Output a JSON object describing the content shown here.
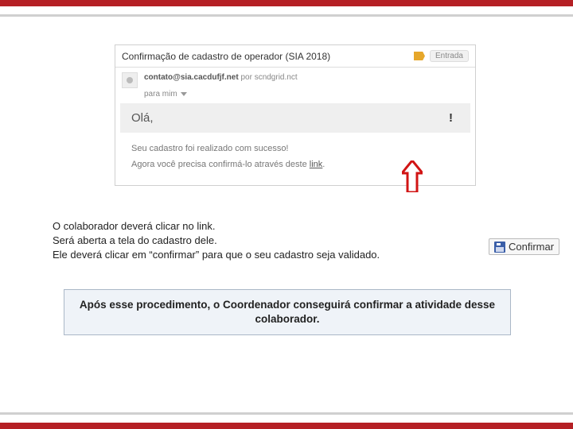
{
  "email": {
    "subject": "Confirmação de cadastro de operador (SIA  2018)",
    "inbox_label": "Entrada",
    "from_address": "contato@sia.cacdufjf.net",
    "via_word": "por",
    "via_domain": "scndgrid.nct",
    "to_line": "para mim",
    "greeting": "Olá,",
    "exclaim": "!",
    "body_line1": "Seu cadastro foi realizado com sucesso!",
    "body_line2_pre": "Agora você precisa confirmá-lo através deste ",
    "body_line2_link": "link",
    "body_line2_post": "."
  },
  "instructions": {
    "l1": "O colaborador deverá clicar no link.",
    "l2": "Será aberta a tela do cadastro dele.",
    "l3": "Ele deverá clicar em “confirmar” para que o seu cadastro seja validado."
  },
  "confirm_button_label": "Confirmar",
  "callout_text": "Após esse procedimento, o Coordenador conseguirá confirmar a atividade desse colaborador."
}
